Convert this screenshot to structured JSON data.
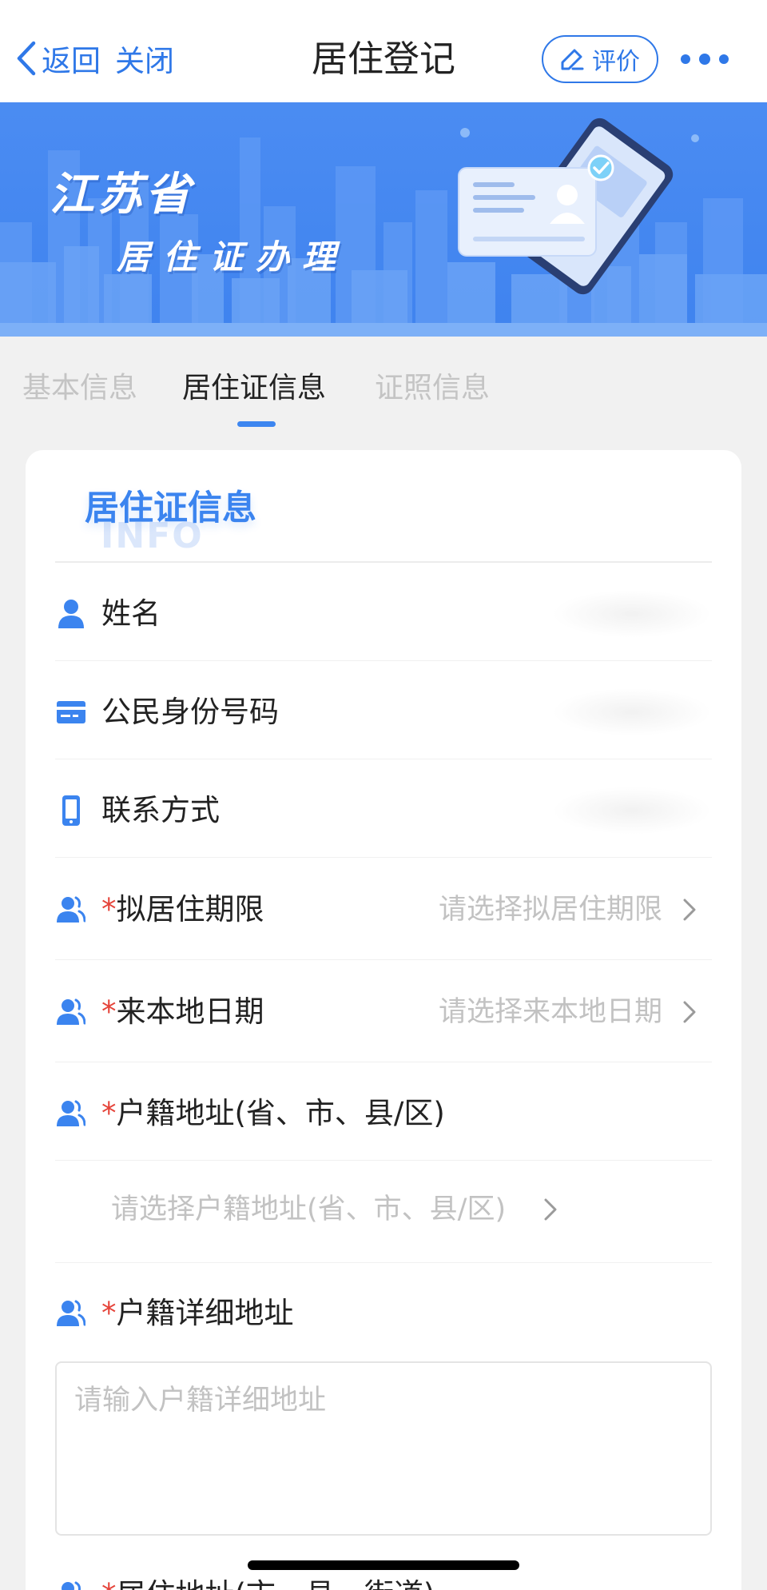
{
  "nav": {
    "back_label": "返回",
    "close_label": "关闭",
    "title": "居住登记",
    "rate_label": "评价"
  },
  "banner": {
    "title": "江苏省",
    "subtitle": "居住证办理"
  },
  "tabs": [
    {
      "label": "基本信息",
      "active": false
    },
    {
      "label": "居住证信息",
      "active": true
    },
    {
      "label": "证照信息",
      "active": false
    }
  ],
  "section": {
    "title": "居住证信息",
    "watermark": "INFO"
  },
  "fields": {
    "name": {
      "label": "姓名",
      "icon": "person-icon"
    },
    "id_number": {
      "label": "公民身份号码",
      "icon": "id-card-icon"
    },
    "contact": {
      "label": "联系方式",
      "icon": "phone-icon"
    },
    "residence_period": {
      "required_mark": "*",
      "label": "拟居住期限",
      "placeholder": "请选择拟居住期限",
      "icon": "people-icon"
    },
    "arrival_date": {
      "required_mark": "*",
      "label": "来本地日期",
      "placeholder": "请选择来本地日期",
      "icon": "people-icon"
    },
    "household_address": {
      "required_mark": "*",
      "label": "户籍地址(省、市、县/区)",
      "placeholder": "请选择户籍地址(省、市、县/区)",
      "icon": "people-icon"
    },
    "household_detail": {
      "required_mark": "*",
      "label": "户籍详细地址",
      "placeholder": "请输入户籍详细地址",
      "icon": "people-icon"
    },
    "residence_address": {
      "required_mark": "*",
      "label": "居住地址(市、县、街道)",
      "icon": "people-icon"
    }
  },
  "colors": {
    "accent": "#2f78e8",
    "required": "#e5443a",
    "banner": "#4a8bf2"
  }
}
